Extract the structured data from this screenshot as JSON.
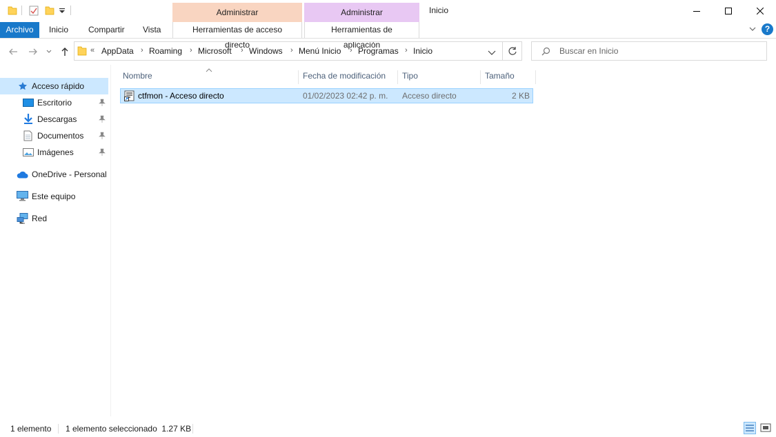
{
  "window": {
    "title": "Inicio",
    "context_groups": [
      {
        "label": "Administrar",
        "color": "#f9d5c1"
      },
      {
        "label": "Administrar",
        "color": "#e8c8f3"
      }
    ]
  },
  "ribbon": {
    "file_tab": "Archivo",
    "tabs": [
      "Inicio",
      "Compartir",
      "Vista"
    ],
    "context_tabs": [
      "Herramientas de acceso directo",
      "Herramientas de aplicación"
    ],
    "accent": "#1979ca"
  },
  "address": {
    "overflow": "«",
    "crumbs": [
      "AppData",
      "Roaming",
      "Microsoft",
      "Windows",
      "Menú Inicio",
      "Programas",
      "Inicio"
    ],
    "separator": "›"
  },
  "search": {
    "placeholder": "Buscar en Inicio"
  },
  "sidebar": {
    "quick_access": "Acceso rápido",
    "pinned": [
      {
        "label": "Escritorio",
        "icon": "desktop-icon"
      },
      {
        "label": "Descargas",
        "icon": "download-icon"
      },
      {
        "label": "Documentos",
        "icon": "document-icon"
      },
      {
        "label": "Imágenes",
        "icon": "pictures-icon"
      }
    ],
    "onedrive": "OneDrive - Personal",
    "this_pc": "Este equipo",
    "network": "Red"
  },
  "columns": [
    "Nombre",
    "Fecha de modificación",
    "Tipo",
    "Tamaño"
  ],
  "files": [
    {
      "name": "ctfmon - Acceso directo",
      "modified": "01/02/2023 02:42 p. m.",
      "type": "Acceso directo",
      "size": "2 KB"
    }
  ],
  "status": {
    "count": "1 elemento",
    "selected": "1 elemento seleccionado  1.27 KB"
  }
}
